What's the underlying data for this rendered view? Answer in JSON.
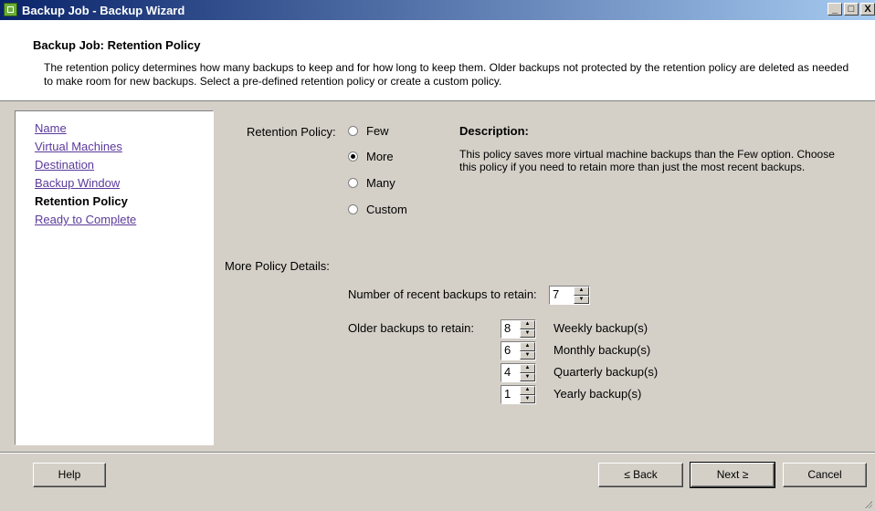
{
  "window": {
    "title": "Backup Job - Backup Wizard",
    "minimize": "_",
    "maximize": "□",
    "close": "X"
  },
  "header": {
    "title": "Backup Job: Retention Policy",
    "description": "The retention policy determines how many backups to keep and for how long to keep them.  Older backups not protected by the retention policy are deleted as needed to make room for new backups.  Select a pre-defined retention policy or create a custom policy."
  },
  "nav": {
    "items": [
      {
        "label": "Name"
      },
      {
        "label": "Virtual Machines"
      },
      {
        "label": "Destination"
      },
      {
        "label": "Backup Window"
      },
      {
        "label": "Retention Policy",
        "current": true
      },
      {
        "label": "Ready to Complete"
      }
    ]
  },
  "policy": {
    "label": "Retention Policy:",
    "options": [
      "Few",
      "More",
      "Many",
      "Custom"
    ],
    "selected": "More"
  },
  "description": {
    "title": "Description:",
    "text": "This policy saves more virtual machine backups than the Few option. Choose this policy if you need to retain more than just the most recent backups."
  },
  "details": {
    "label": "More Policy Details:",
    "recent_label": "Number of recent backups to retain:",
    "recent_value": "7",
    "older_label": "Older backups to retain:",
    "older": [
      {
        "value": "8",
        "label": "Weekly backup(s)"
      },
      {
        "value": "6",
        "label": "Monthly backup(s)"
      },
      {
        "value": "4",
        "label": "Quarterly backup(s)"
      },
      {
        "value": "1",
        "label": "Yearly backup(s)"
      }
    ]
  },
  "buttons": {
    "help": "Help",
    "back": "≤ Back",
    "next": "Next ≥",
    "cancel": "Cancel"
  }
}
